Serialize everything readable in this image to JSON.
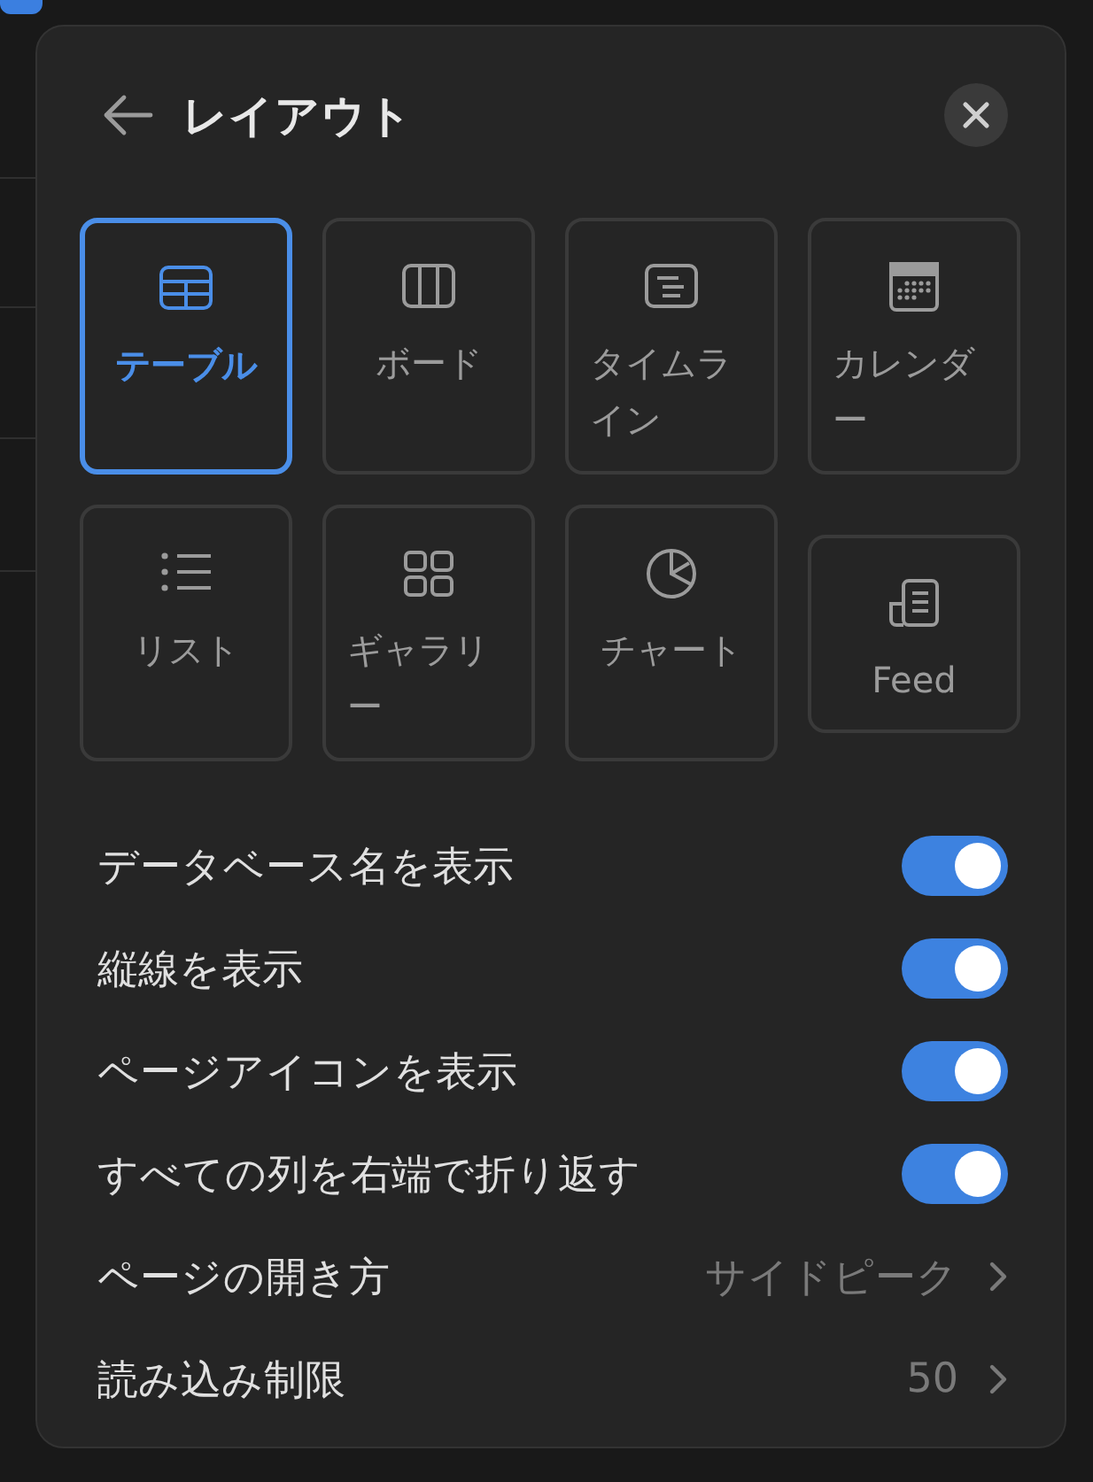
{
  "panel": {
    "title": "レイアウト"
  },
  "layouts": [
    {
      "label": "テーブル",
      "kind": "view",
      "selected": true
    },
    {
      "label": "ボード",
      "kind": "view",
      "selected": false
    },
    {
      "label": "タイムライン",
      "kind": "view",
      "selected": false
    },
    {
      "label": "カレンダー",
      "kind": "view",
      "selected": false
    },
    {
      "label": "リスト",
      "kind": "view",
      "selected": false
    },
    {
      "label": "ギャラリー",
      "kind": "view",
      "selected": false
    },
    {
      "label": "チャート",
      "kind": "view",
      "selected": false
    },
    {
      "label": "Feed",
      "kind": "compact",
      "selected": false
    }
  ],
  "settings": [
    {
      "label": "データベース名を表示",
      "kind": "toggle",
      "on": true
    },
    {
      "label": "縦線を表示",
      "kind": "toggle",
      "on": true
    },
    {
      "label": "ページアイコンを表示",
      "kind": "toggle",
      "on": true
    },
    {
      "label": "すべての列を右端で折り返す",
      "kind": "toggle",
      "on": true
    },
    {
      "label": "ページの開き方",
      "kind": "select",
      "value": "サイドピーク"
    },
    {
      "label": "読み込み制限",
      "kind": "select",
      "value": "50"
    }
  ]
}
